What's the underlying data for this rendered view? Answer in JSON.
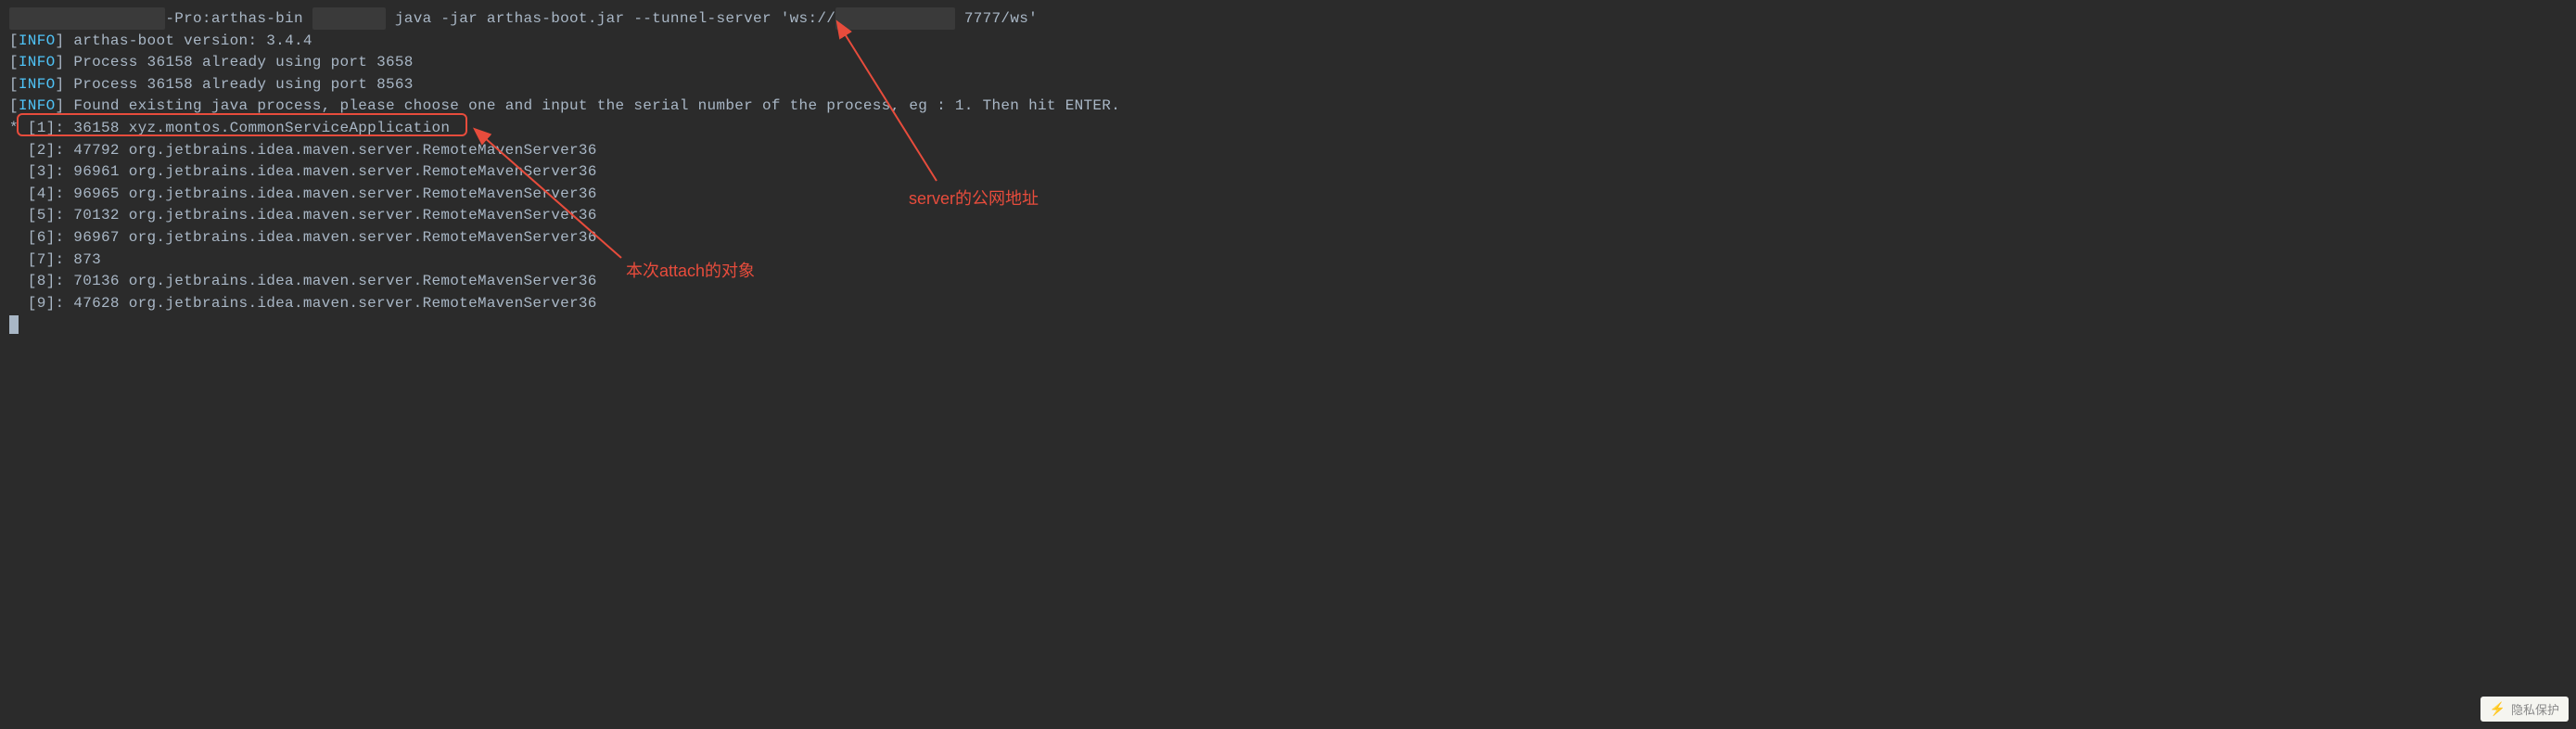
{
  "prompt": {
    "prefix_hidden": "████████████ ████",
    "host_suffix": "-Pro:arthas-bin",
    "user_hidden": "████████",
    "command_before": " java -jar arthas-boot.jar --tunnel-server 'ws://",
    "ip_hidden": "███ ██ ███ ██",
    "command_after": "7777/ws'"
  },
  "info_lines": [
    "arthas-boot version: 3.4.4",
    "Process 36158 already using port 3658",
    "Process 36158 already using port 8563",
    "Found existing java process, please choose one and input the serial number of the process, eg : 1. Then hit ENTER."
  ],
  "info_tag": "INFO",
  "selected_marker": "*",
  "selected_line": " [1]: 36158 xyz.montos.CommonServiceApplication",
  "process_lines": [
    "  [2]: 47792 org.jetbrains.idea.maven.server.RemoteMavenServer36",
    "  [3]: 96961 org.jetbrains.idea.maven.server.RemoteMavenServer36",
    "  [4]: 96965 org.jetbrains.idea.maven.server.RemoteMavenServer36",
    "  [5]: 70132 org.jetbrains.idea.maven.server.RemoteMavenServer36",
    "  [6]: 96967 org.jetbrains.idea.maven.server.RemoteMavenServer36",
    "  [7]: 873",
    "  [8]: 70136 org.jetbrains.idea.maven.server.RemoteMavenServer36",
    "  [9]: 47628 org.jetbrains.idea.maven.server.RemoteMavenServer36"
  ],
  "annotations": {
    "server_addr": "server的公网地址",
    "attach_target": "本次attach的对象"
  },
  "watermark": "隐私保护"
}
